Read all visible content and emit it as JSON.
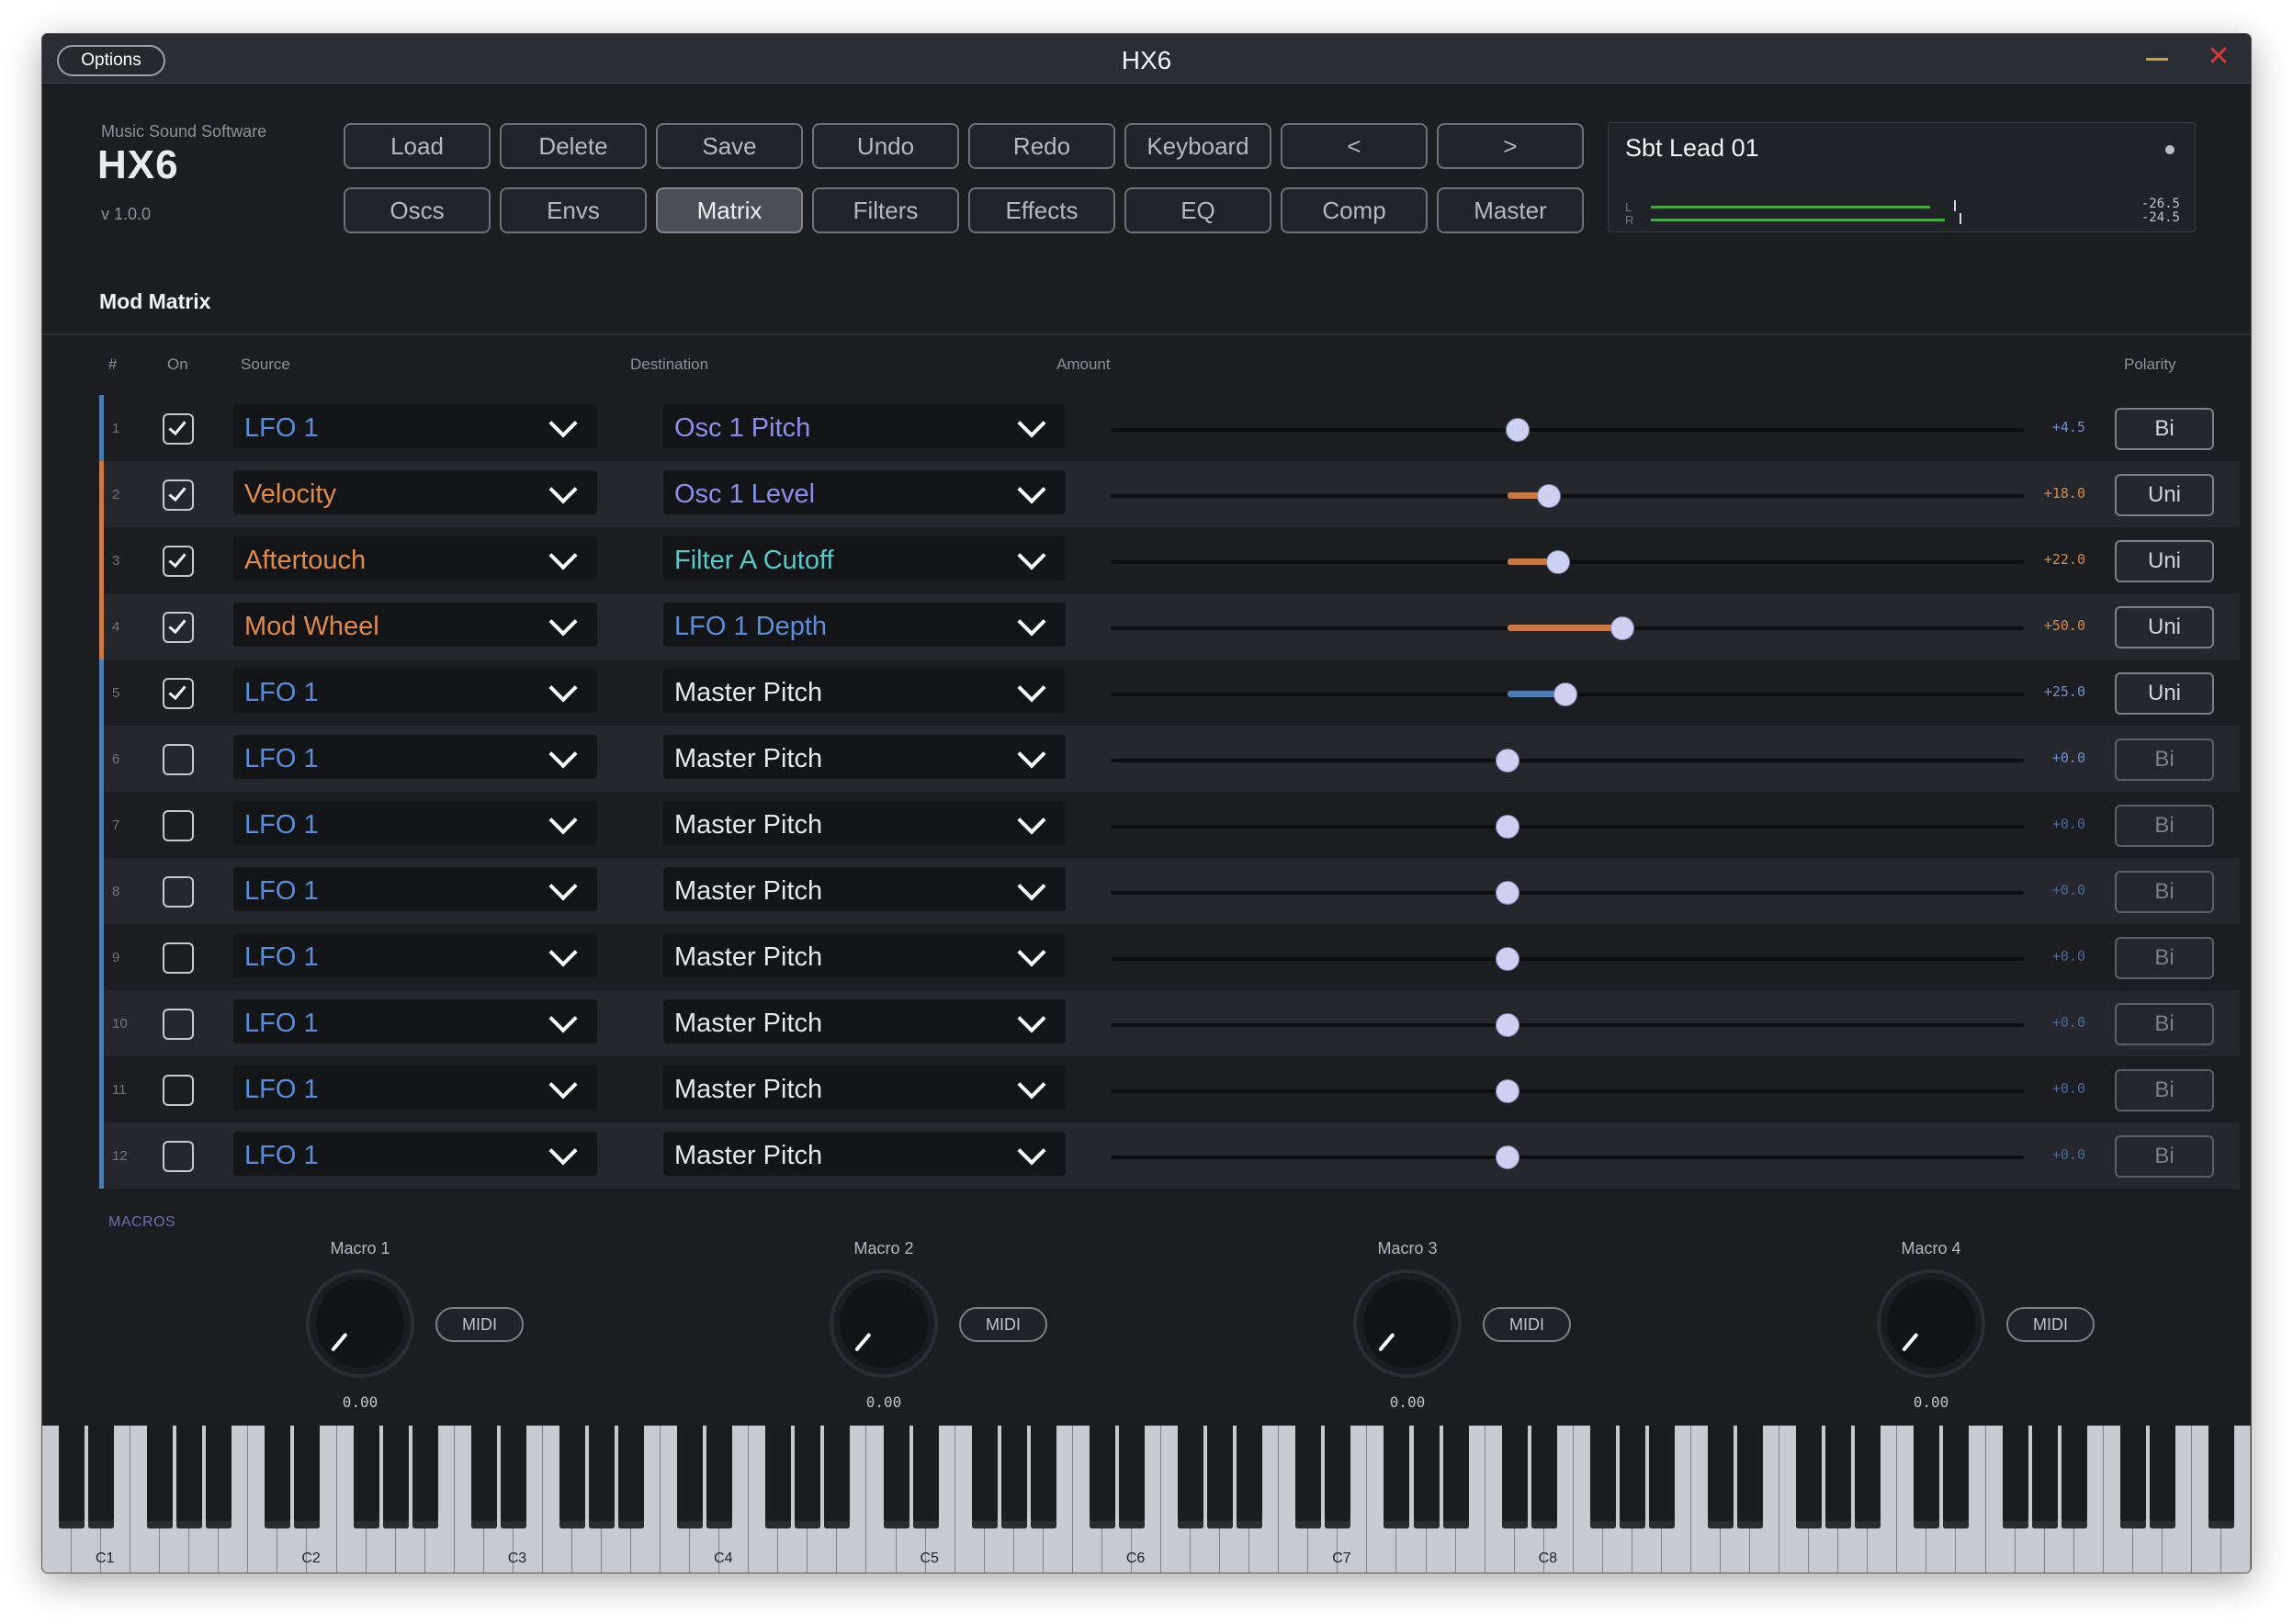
{
  "titlebar": {
    "options_label": "Options",
    "title": "HX6",
    "close_glyph": "✕"
  },
  "brand": {
    "company": "Music Sound Software",
    "logo": "HX6",
    "version": "v 1.0.0"
  },
  "toolbar": {
    "row1": [
      "Load",
      "Delete",
      "Save",
      "Undo",
      "Redo",
      "Keyboard",
      "<",
      ">"
    ],
    "row2": [
      "Oscs",
      "Envs",
      "Matrix",
      "Filters",
      "Effects",
      "EQ",
      "Comp",
      "Master"
    ],
    "active_tab": "Matrix"
  },
  "preset": {
    "name": "Sbt Lead 01",
    "meter_l_label": "L",
    "meter_r_label": "R",
    "meter_l_value": "-26.5",
    "meter_r_value": "-24.5"
  },
  "section_title": "Mod Matrix",
  "columns": {
    "num": "#",
    "on": "On",
    "source": "Source",
    "destination": "Destination",
    "amount": "Amount",
    "polarity": "Polarity"
  },
  "colors": {
    "lfo": "#5b8ed8",
    "controller": "#e08a4a",
    "cutoff": "#58c8c8",
    "dest_default": "#e6e8ec",
    "dest_osc": "#8d8ee8",
    "accent_orange": "#c77a45",
    "accent_blue": "#4f7cb0",
    "amount_blue": "#6c8fd8",
    "amount_orange": "#d88a4a"
  },
  "matrix_rows": [
    {
      "num": "1",
      "on": true,
      "source": "LFO 1",
      "destination": "Osc 1 Pitch",
      "amount": "+4.5",
      "amount_value": 4.5,
      "polarity": "Bi"
    },
    {
      "num": "2",
      "on": true,
      "source": "Velocity",
      "destination": "Osc 1 Level",
      "amount": "+18.0",
      "amount_value": 18.0,
      "polarity": "Uni"
    },
    {
      "num": "3",
      "on": true,
      "source": "Aftertouch",
      "destination": "Filter A Cutoff",
      "amount": "+22.0",
      "amount_value": 22.0,
      "polarity": "Uni"
    },
    {
      "num": "4",
      "on": true,
      "source": "Mod Wheel",
      "destination": "LFO 1 Depth",
      "amount": "+50.0",
      "amount_value": 50.0,
      "polarity": "Uni"
    },
    {
      "num": "5",
      "on": true,
      "source": "LFO 1",
      "destination": "Master Pitch",
      "amount": "+25.0",
      "amount_value": 25.0,
      "polarity": "Uni"
    },
    {
      "num": "6",
      "on": false,
      "source": "LFO 1",
      "destination": "Master Pitch",
      "amount": "+0.0",
      "amount_value": 0,
      "polarity": "Bi"
    },
    {
      "num": "7",
      "on": false,
      "source": "LFO 1",
      "destination": "Master Pitch",
      "amount": "+0.0",
      "amount_value": 0,
      "polarity": "Bi"
    },
    {
      "num": "8",
      "on": false,
      "source": "LFO 1",
      "destination": "Master Pitch",
      "amount": "+0.0",
      "amount_value": 0,
      "polarity": "Bi"
    },
    {
      "num": "9",
      "on": false,
      "source": "LFO 1",
      "destination": "Master Pitch",
      "amount": "+0.0",
      "amount_value": 0,
      "polarity": "Bi"
    },
    {
      "num": "10",
      "on": false,
      "source": "LFO 1",
      "destination": "Master Pitch",
      "amount": "+0.0",
      "amount_value": 0,
      "polarity": "Bi"
    },
    {
      "num": "11",
      "on": false,
      "source": "LFO 1",
      "destination": "Master Pitch",
      "amount": "+0.0",
      "amount_value": 0,
      "polarity": "Bi"
    },
    {
      "num": "12",
      "on": false,
      "source": "LFO 1",
      "destination": "Master Pitch",
      "amount": "+0.0",
      "amount_value": 0,
      "polarity": "Bi"
    }
  ],
  "macros": {
    "title": "MACROS",
    "items": [
      {
        "label": "Macro 1",
        "midi": "MIDI",
        "value": "0.00"
      },
      {
        "label": "Macro 2",
        "midi": "MIDI",
        "value": "0.00"
      },
      {
        "label": "Macro 3",
        "midi": "MIDI",
        "value": "0.00"
      },
      {
        "label": "Macro 4",
        "midi": "MIDI",
        "value": "0.00"
      }
    ]
  },
  "keyboard": {
    "octave_labels": [
      "C1",
      "C2",
      "C3",
      "C4",
      "C5",
      "C6",
      "C7",
      "C8"
    ]
  }
}
